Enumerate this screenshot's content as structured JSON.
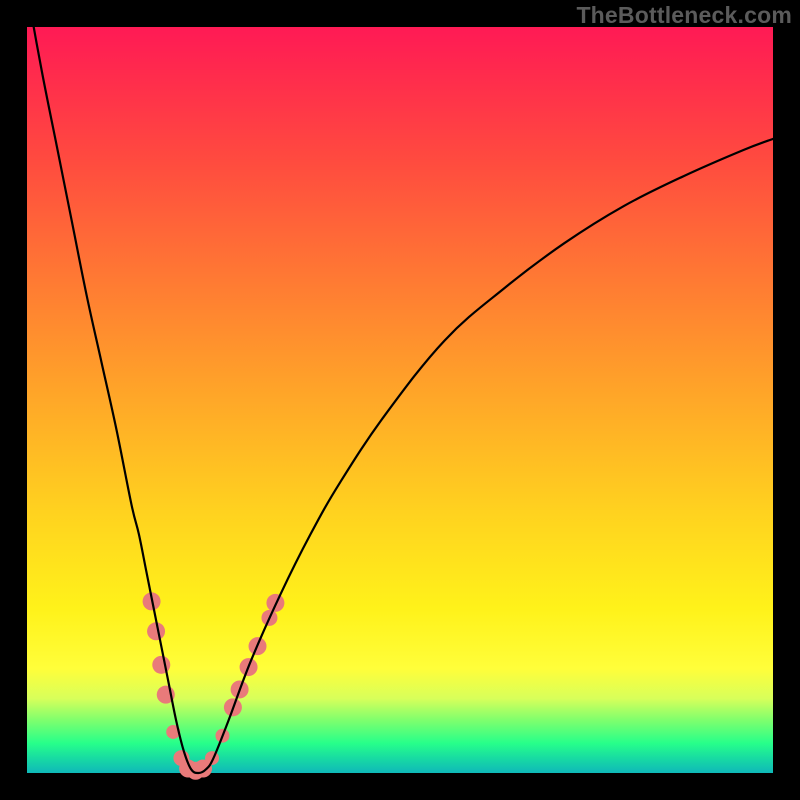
{
  "watermark": "TheBottleneck.com",
  "chart_data": {
    "type": "line",
    "title": "",
    "xlabel": "",
    "ylabel": "",
    "xlim": [
      0,
      100
    ],
    "ylim": [
      0,
      100
    ],
    "series": [
      {
        "name": "curve",
        "x": [
          0,
          2,
          4,
          6,
          8,
          10,
          12,
          14,
          15,
          16,
          17,
          18,
          19,
          20,
          21,
          22,
          23,
          24,
          25,
          27,
          30,
          34,
          38,
          42,
          48,
          56,
          64,
          72,
          80,
          88,
          96,
          100
        ],
        "values": [
          105,
          94,
          84,
          74,
          64,
          55,
          46,
          36,
          32,
          27,
          22,
          17,
          12,
          7,
          3,
          0.5,
          0,
          0.5,
          2,
          7,
          15,
          24,
          32,
          39,
          48,
          58,
          65,
          71,
          76,
          80,
          83.5,
          85
        ]
      }
    ],
    "markers": {
      "name": "band-dots",
      "color": "#e97a7a",
      "points": [
        {
          "x": 16.7,
          "y": 23,
          "r": 9
        },
        {
          "x": 17.3,
          "y": 19,
          "r": 9
        },
        {
          "x": 18.0,
          "y": 14.5,
          "r": 9
        },
        {
          "x": 18.6,
          "y": 10.5,
          "r": 9
        },
        {
          "x": 19.6,
          "y": 5.5,
          "r": 7
        },
        {
          "x": 20.7,
          "y": 2.0,
          "r": 8
        },
        {
          "x": 21.6,
          "y": 0.6,
          "r": 9
        },
        {
          "x": 22.6,
          "y": 0.3,
          "r": 9
        },
        {
          "x": 23.6,
          "y": 0.6,
          "r": 9
        },
        {
          "x": 24.8,
          "y": 2.0,
          "r": 7
        },
        {
          "x": 26.2,
          "y": 5.0,
          "r": 7
        },
        {
          "x": 27.6,
          "y": 8.8,
          "r": 9
        },
        {
          "x": 28.5,
          "y": 11.2,
          "r": 9
        },
        {
          "x": 29.7,
          "y": 14.2,
          "r": 9
        },
        {
          "x": 30.9,
          "y": 17.0,
          "r": 9
        },
        {
          "x": 32.5,
          "y": 20.8,
          "r": 8
        },
        {
          "x": 33.3,
          "y": 22.8,
          "r": 9
        }
      ]
    }
  }
}
